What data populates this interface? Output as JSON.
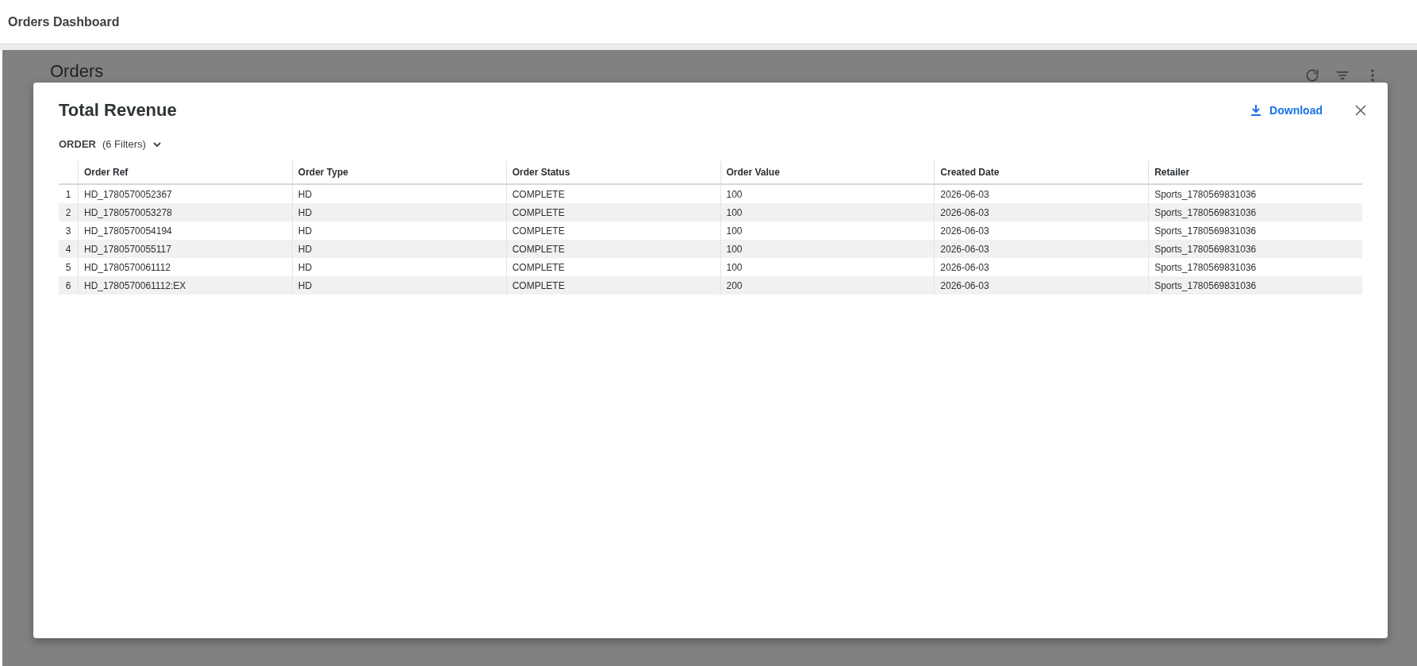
{
  "app_bar": {
    "title": "Orders Dashboard"
  },
  "background_page": {
    "title": "Orders"
  },
  "dialog": {
    "title": "Total Revenue",
    "download_label": "Download",
    "filter": {
      "entity": "ORDER",
      "count": "(6 Filters)"
    },
    "table": {
      "columns": [
        "Order Ref",
        "Order Type",
        "Order Status",
        "Order Value",
        "Created Date",
        "Retailer"
      ],
      "rows": [
        {
          "index": "1",
          "cells": [
            "HD_1780570052367",
            "HD",
            "COMPLETE",
            "100",
            "2026-06-03",
            "Sports_1780569831036"
          ]
        },
        {
          "index": "2",
          "cells": [
            "HD_1780570053278",
            "HD",
            "COMPLETE",
            "100",
            "2026-06-03",
            "Sports_1780569831036"
          ]
        },
        {
          "index": "3",
          "cells": [
            "HD_1780570054194",
            "HD",
            "COMPLETE",
            "100",
            "2026-06-03",
            "Sports_1780569831036"
          ]
        },
        {
          "index": "4",
          "cells": [
            "HD_1780570055117",
            "HD",
            "COMPLETE",
            "100",
            "2026-06-03",
            "Sports_1780569831036"
          ]
        },
        {
          "index": "5",
          "cells": [
            "HD_1780570061112",
            "HD",
            "COMPLETE",
            "100",
            "2026-06-03",
            "Sports_1780569831036"
          ]
        },
        {
          "index": "6",
          "cells": [
            "HD_1780570061112:EX",
            "HD",
            "COMPLETE",
            "200",
            "2026-06-03",
            "Sports_1780569831036"
          ]
        }
      ]
    }
  }
}
